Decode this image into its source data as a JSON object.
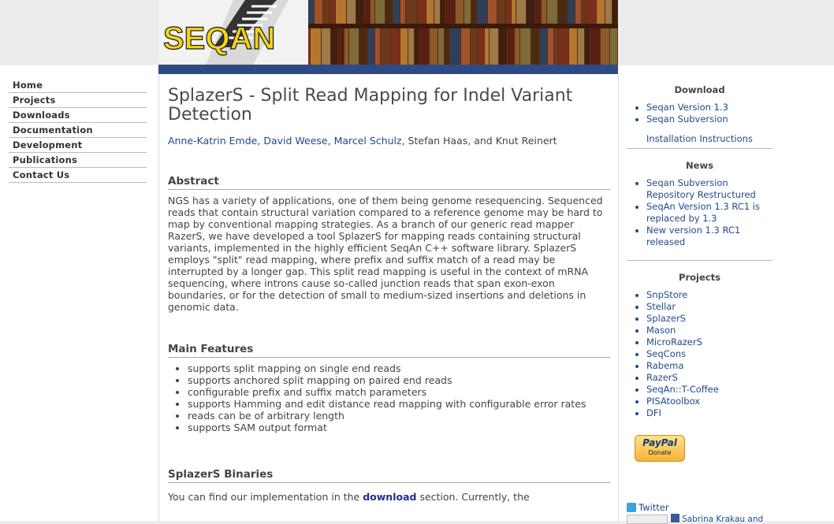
{
  "banner": {
    "logo_text": "SEQAN"
  },
  "nav": {
    "items": [
      {
        "label": "Home"
      },
      {
        "label": "Projects"
      },
      {
        "label": "Downloads"
      },
      {
        "label": "Documentation"
      },
      {
        "label": "Development"
      },
      {
        "label": "Publications"
      },
      {
        "label": "Contact Us"
      }
    ]
  },
  "main": {
    "title": "SplazerS - Split Read Mapping for Indel Variant Detection",
    "authors": {
      "a1": "Anne-Katrin Emde",
      "a2": "David Weese",
      "a3": "Marcel Schulz",
      "sep": ",",
      "rest": "Stefan Haas, and Knut Reinert"
    },
    "abstract_heading": "Abstract",
    "abstract_text": "NGS has a variety of applications, one of them being genome resequencing. Sequenced reads that contain structural variation compared to a reference genome may be hard to map by conventional mapping strategies. As a branch of our generic read mapper RazerS, we have developed a tool SplazerS for mapping reads containing structural variants, implemented in the highly efficient SeqAn C++ software library. SplazerS employs \"split\" read mapping, where prefix and suffix match of a read may be interrupted by a longer gap. This split read mapping is useful in the context of mRNA sequencing, where introns cause so-called junction reads that span exon-exon boundaries, or for the detection of small to medium-sized insertions and deletions in genomic data.",
    "features_heading": "Main Features",
    "features": [
      "supports split mapping on single end reads",
      "supports anchored split mapping on paired end reads",
      "configurable prefix and suffix match parameters",
      "supports Hamming and edit distance read mapping with configurable error rates",
      "reads can be of arbitrary length",
      "supports SAM output format"
    ],
    "binaries_heading": "SplazerS Binaries",
    "binaries_pre": "You can find our implementation in the",
    "binaries_link": "download",
    "binaries_post": "section. Currently, the"
  },
  "sidebar": {
    "download_heading": "Download",
    "download_items": [
      "Seqan Version 1.3",
      "Seqan Subversion"
    ],
    "install_link": "Installation Instructions",
    "news_heading": "News",
    "news_items": [
      "Seqan Subversion Repository Restructured",
      "SeqAn Version 1.3 RC1 is replaced by 1.3",
      "New version 1.3 RC1 released"
    ],
    "projects_heading": "Projects",
    "projects_items": [
      "SnpStore",
      "Stellar",
      "SplazerS",
      "Mason",
      "MicroRazerS",
      "SeqCons",
      "Rabema",
      "RazerS",
      "SeqAn::T-Coffee",
      "PISAtoolbox",
      "DFI"
    ],
    "paypal_brand": "PayPal",
    "paypal_label": "Donate",
    "twitter_label": "Twitter",
    "fb_text": "Sabrina Krakau and"
  },
  "colors": {
    "link": "#1f4a8a",
    "banner_bg": "#5a2e12",
    "logo_yellow": "#f2d21b"
  }
}
